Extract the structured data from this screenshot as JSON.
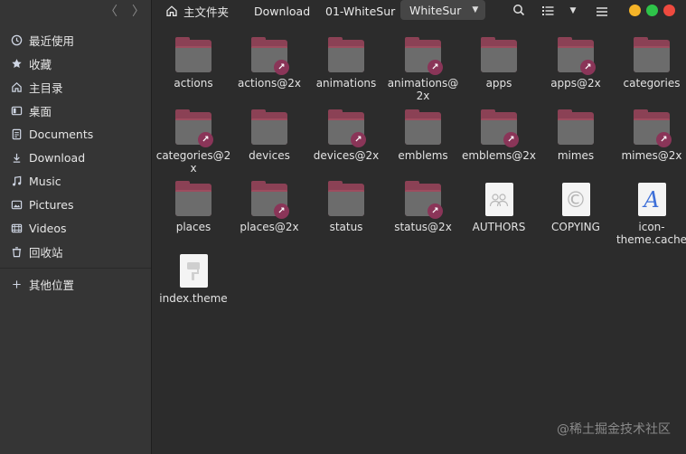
{
  "sidebar": {
    "items": [
      {
        "label": "最近使用",
        "icon": "clock-icon"
      },
      {
        "label": "收藏",
        "icon": "star-icon"
      },
      {
        "label": "主目录",
        "icon": "home-icon"
      },
      {
        "label": "桌面",
        "icon": "desktop-icon"
      },
      {
        "label": "Documents",
        "icon": "document-icon"
      },
      {
        "label": "Download",
        "icon": "download-icon"
      },
      {
        "label": "Music",
        "icon": "music-icon"
      },
      {
        "label": "Pictures",
        "icon": "picture-icon"
      },
      {
        "label": "Videos",
        "icon": "video-icon"
      },
      {
        "label": "回收站",
        "icon": "trash-icon"
      }
    ],
    "other_locations": "其他位置"
  },
  "nav": {
    "back": "〈",
    "forward": "〉"
  },
  "breadcrumb": {
    "home": "主文件夹",
    "download": "Download",
    "parent": "01-WhiteSur",
    "current": "WhiteSur"
  },
  "toolbar": {
    "search_icon": "search-icon",
    "list_view_icon": "list-view-icon",
    "sort_menu_icon": "dropdown-icon",
    "menu_icon": "hamburger-menu-icon"
  },
  "window_controls": {
    "minimize_color": "#f5b428",
    "maximize_color": "#2ec449",
    "close_color": "#ee4a3f"
  },
  "files": [
    {
      "name": "actions",
      "type": "folder",
      "link": false
    },
    {
      "name": "actions@2x",
      "type": "folder",
      "link": true
    },
    {
      "name": "animations",
      "type": "folder",
      "link": false
    },
    {
      "name": "animations@2x",
      "type": "folder",
      "link": true
    },
    {
      "name": "apps",
      "type": "folder",
      "link": false
    },
    {
      "name": "apps@2x",
      "type": "folder",
      "link": true
    },
    {
      "name": "categories",
      "type": "folder",
      "link": false
    },
    {
      "name": "categories@2x",
      "type": "folder",
      "link": true
    },
    {
      "name": "devices",
      "type": "folder",
      "link": false
    },
    {
      "name": "devices@2x",
      "type": "folder",
      "link": true
    },
    {
      "name": "emblems",
      "type": "folder",
      "link": false
    },
    {
      "name": "emblems@2x",
      "type": "folder",
      "link": true
    },
    {
      "name": "mimes",
      "type": "folder",
      "link": false
    },
    {
      "name": "mimes@2x",
      "type": "folder",
      "link": true
    },
    {
      "name": "places",
      "type": "folder",
      "link": false
    },
    {
      "name": "places@2x",
      "type": "folder",
      "link": true
    },
    {
      "name": "status",
      "type": "folder",
      "link": false
    },
    {
      "name": "status@2x",
      "type": "folder",
      "link": true
    },
    {
      "name": "AUTHORS",
      "type": "authors"
    },
    {
      "name": "COPYING",
      "type": "copying"
    },
    {
      "name": "icon-theme.cache",
      "type": "cache",
      "glyph": "A"
    },
    {
      "name": "index.theme",
      "type": "theme"
    }
  ],
  "watermark": "@稀土掘金技术社区",
  "link_arrow": "↗",
  "copy_glyph": "©"
}
